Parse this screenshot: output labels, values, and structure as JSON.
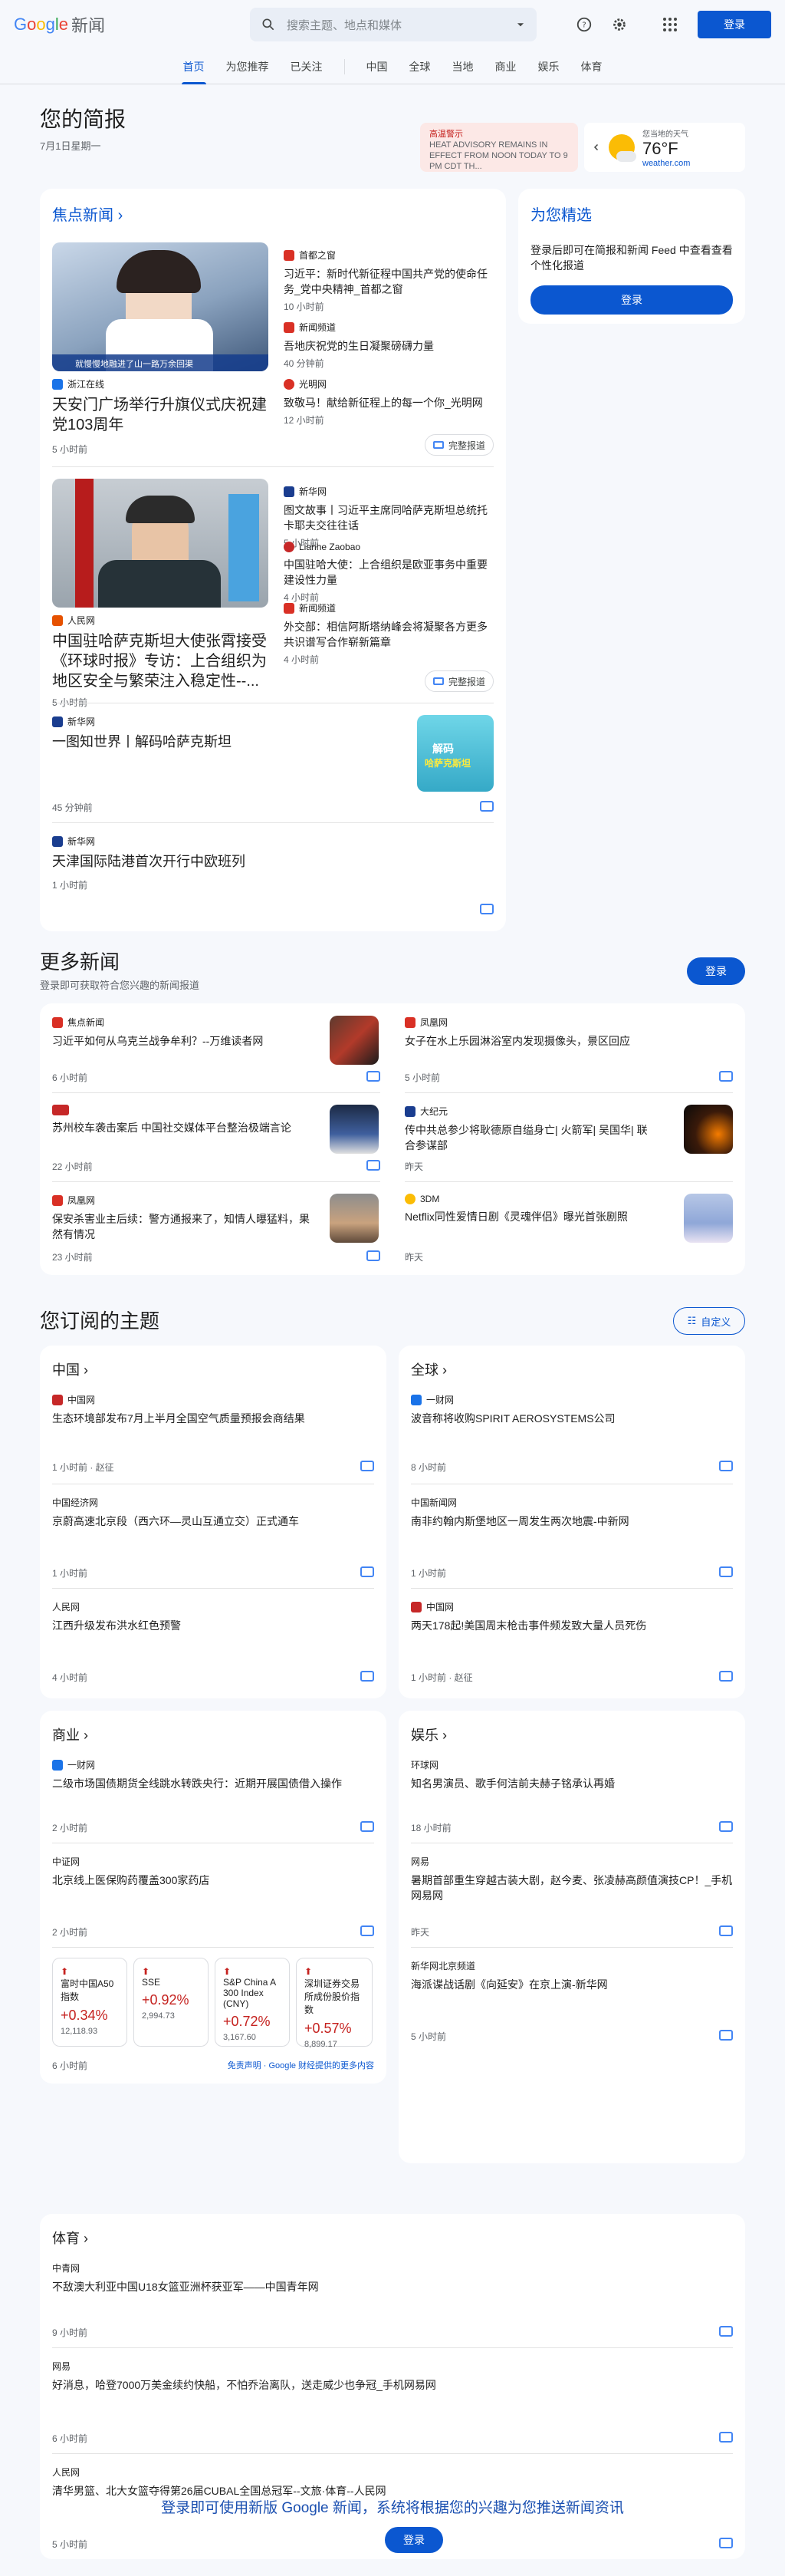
{
  "header": {
    "logo_news": "新闻",
    "search_placeholder": "搜索主题、地点和媒体",
    "signin": "登录"
  },
  "nav": [
    "首页",
    "为您推荐",
    "已关注",
    "中国",
    "全球",
    "当地",
    "商业",
    "娱乐",
    "体育"
  ],
  "brief": {
    "title": "您的简报",
    "date": "7月1日星期一"
  },
  "alert": {
    "label": "高温警示",
    "text": "HEAT ADVISORY REMAINS IN EFFECT FROM NOON TODAY TO 9 PM CDT TH..."
  },
  "weather": {
    "label": "您当地的天气",
    "temp": "76°F",
    "site": "weather.com"
  },
  "headlines": {
    "title": "焦点新闻",
    "full_coverage": "完整报道",
    "c1": {
      "main": {
        "source": "浙江在线",
        "title": "天安门广场举行升旗仪式庆祝建党103周年",
        "time": "5 小时前",
        "caption": "就慢慢地融进了山一路万余回渠"
      },
      "side": [
        {
          "source": "首都之窗",
          "title": "习近平：新时代新征程中国共产党的使命任务_党中央精神_首都之窗",
          "time": "10 小时前"
        },
        {
          "source": "新闻频道",
          "title": "吾地庆祝党的生日凝聚磅礴力量",
          "time": "40 分钟前"
        },
        {
          "source": "光明网",
          "title": "致敬马！献给新征程上的每一个你_光明网",
          "time": "12 小时前"
        }
      ]
    },
    "c2": {
      "main": {
        "source": "人民网",
        "title": "中国驻哈萨克斯坦大使张霄接受《环球时报》专访：上合组织为地区安全与繁荣注入稳定性--...",
        "time": "5 小时前"
      },
      "side": [
        {
          "source": "新华网",
          "title": "图文故事丨习近平主席同哈萨克斯坦总统托卡耶夫交往往话",
          "time": "5 小时前"
        },
        {
          "source": "Lianhe Zaobao",
          "title": "中国驻哈大使：上合组织是欧亚事务中重要建设性力量",
          "time": "4 小时前"
        },
        {
          "source": "新闻频道",
          "title": "外交部：相信阿斯塔纳峰会将凝聚各方更多共识谱写合作崭新篇章",
          "time": "4 小时前"
        }
      ]
    },
    "c3": {
      "source": "新华网",
      "title": "一图知世界丨解码哈萨克斯坦",
      "time": "45 分钟前",
      "thumb_text1": "解码",
      "thumb_text2": "哈萨克斯坦"
    },
    "c4": {
      "source": "新华网",
      "title": "天津国际陆港首次开行中欧班列",
      "time": "1 小时前"
    }
  },
  "picks": {
    "title": "为您精选",
    "text": "登录后即可在简报和新闻 Feed 中查看查看个性化报道",
    "button": "登录"
  },
  "more": {
    "title": "更多新闻",
    "sub": "登录即可获取符合您兴趣的新闻报道",
    "button": "登录",
    "items": [
      {
        "source": "焦点新闻",
        "title": "习近平如何从乌克兰战争牟利？--万维读者网",
        "time": "6 小时前"
      },
      {
        "source": "凤凰网",
        "title": "女子在水上乐园淋浴室内发现摄像头，景区回应",
        "time": "5 小时前"
      },
      {
        "source": "",
        "title": "苏州校车袭击案后 中国社交媒体平台整治极端言论",
        "time": "22 小时前"
      },
      {
        "source": "大纪元",
        "title": "传中共总参少将耿德原自缢身亡| 火箭军| 吴国华| 联合参谋部",
        "time": "昨天"
      },
      {
        "source": "凤凰网",
        "title": "保安杀害业主后续：警方通报来了，知情人曝猛料，果然有情况",
        "time": "23 小时前"
      },
      {
        "source": "3DM",
        "title": "Netflix同性爱情日剧《灵魂伴侣》曝光首张剧照",
        "time": "昨天"
      }
    ]
  },
  "topics": {
    "title": "您订阅的主题",
    "customize": "自定义",
    "china": {
      "title": "中国",
      "items": [
        {
          "source": "中国网",
          "title": "生态环境部发布7月上半月全国空气质量预报会商结果",
          "time": "1 小时前 · 赵征"
        },
        {
          "source": "中国经济网",
          "title": "京蔚高速北京段（西六环—灵山互通立交）正式通车",
          "time": "1 小时前"
        },
        {
          "source": "人民网",
          "title": "江西升级发布洪水红色预警",
          "time": "4 小时前"
        }
      ]
    },
    "world": {
      "title": "全球",
      "items": [
        {
          "source": "一财网",
          "title": "波音称将收购SPIRIT AEROSYSTEMS公司",
          "time": "8 小时前"
        },
        {
          "source": "中国新闻网",
          "title": "南非约翰内斯堡地区一周发生两次地震-中新网",
          "time": "1 小时前"
        },
        {
          "source": "中国网",
          "title": "两天178起!美国周末枪击事件频发致大量人员死伤",
          "time": "1 小时前 · 赵征"
        }
      ]
    },
    "business": {
      "title": "商业",
      "items": [
        {
          "source": "一财网",
          "title": "二级市场国债期货全线跳水转跌央行：近期开展国债借入操作",
          "time": "2 小时前"
        },
        {
          "source": "中证网",
          "title": "北京线上医保购药覆盖300家药店",
          "time": "2 小时前"
        }
      ],
      "stocks": [
        {
          "name": "富时中国A50指数",
          "pct": "+0.34%",
          "val": "12,118.93"
        },
        {
          "name": "SSE",
          "pct": "+0.92%",
          "val": "2,994.73"
        },
        {
          "name": "S&P China A 300 Index (CNY)",
          "pct": "+0.72%",
          "val": "3,167.60"
        },
        {
          "name": "深圳证券交易所成份股价指数",
          "pct": "+0.57%",
          "val": "8,899.17"
        }
      ],
      "time": "6 小时前",
      "disclaimer": "免责声明 · Google 财经提供的更多内容"
    },
    "ent": {
      "title": "娱乐",
      "items": [
        {
          "source": "环球网",
          "title": "知名男演员、歌手何洁前夫赫子铭承认再婚",
          "time": "18 小时前"
        },
        {
          "source": "网易",
          "title": "暑期首部重生穿越古装大剧，赵今麦、张凌赫高颜值演技CP！_手机网易网",
          "time": "昨天"
        },
        {
          "source": "新华网北京频道",
          "title": "海派谍战话剧《向延安》在京上演-新华网",
          "time": "5 小时前"
        }
      ]
    },
    "sports": {
      "title": "体育",
      "items": [
        {
          "source": "中青网",
          "title": "不敌澳大利亚中国U18女篮亚洲杯获亚军——中国青年网",
          "time": "9 小时前"
        },
        {
          "source": "网易",
          "title": "好消息，哈登7000万美金续约快船，不怕乔治离队，送走威少也争冠_手机网易网",
          "time": "6 小时前"
        },
        {
          "source": "人民网",
          "title": "清华男篮、北大女篮夺得第26届CUBAL全国总冠军--文旅·体育--人民网",
          "time": "5 小时前"
        }
      ]
    }
  },
  "footer": {
    "text": "登录即可使用新版 Google 新闻，系统将根据您的兴趣为您推送新闻资讯",
    "button": "登录"
  }
}
